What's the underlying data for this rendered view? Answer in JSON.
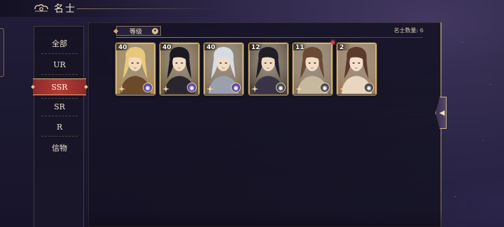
{
  "header": {
    "title": "名士",
    "emblem_icon": "cloud-swirl-icon"
  },
  "sidebar": {
    "items": [
      {
        "label": "全部",
        "active": false
      },
      {
        "label": "UR",
        "active": false
      },
      {
        "label": "SSR",
        "active": true
      },
      {
        "label": "SR",
        "active": false
      },
      {
        "label": "R",
        "active": false
      },
      {
        "label": "信物",
        "active": false
      }
    ],
    "active_color": "#b53a36"
  },
  "toolbar": {
    "sort_label": "等级",
    "sort_icon": "chevron-down-icon",
    "count_text": "名士数量: 6"
  },
  "cards": [
    {
      "level": "40",
      "badge": "purple",
      "badge_icon": "eye-icon",
      "hair": "#e8c87a",
      "bg": "#a8894f",
      "skin": "#f3d9b8",
      "robe": "#6b4a2a"
    },
    {
      "level": "40",
      "badge": "purple",
      "badge_icon": "eye-icon",
      "hair": "#1c1a20",
      "bg": "#6b5a3e",
      "skin": "#f1dcc4",
      "robe": "#2a2630"
    },
    {
      "level": "40",
      "badge": "purple",
      "badge_icon": "eye-icon",
      "hair": "#d7dbe4",
      "bg": "#7b6c58",
      "skin": "#f0dcc6",
      "robe": "#9aa0ad"
    },
    {
      "level": "12",
      "badge": "grey",
      "badge_icon": "eye-icon",
      "hair": "#221e28",
      "bg": "#4d4036",
      "skin": "#efd8c2",
      "robe": "#3a3348"
    },
    {
      "level": "11",
      "badge": "grey",
      "badge_icon": "eye-icon",
      "hair": "#6a4a34",
      "bg": "#8a7660",
      "skin": "#f2dcc4",
      "robe": "#c7b8a0"
    },
    {
      "level": "2",
      "badge": "grey",
      "badge_icon": "eye-icon",
      "hair": "#5a3a2a",
      "bg": "#9c7a5e",
      "skin": "#f6dfcc",
      "robe": "#e8d6c0"
    }
  ],
  "collapse_icon": "chevron-left-icon"
}
